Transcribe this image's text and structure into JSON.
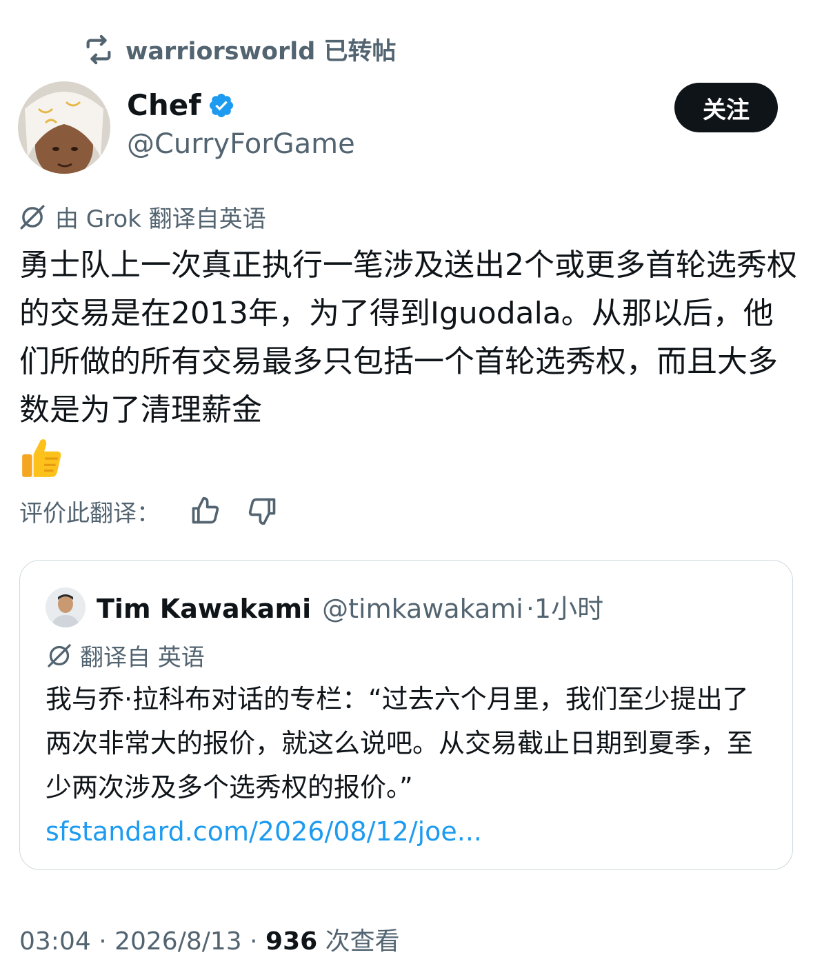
{
  "repost": {
    "text": "warriorsworld 已转帖",
    "icon": "repost-icon"
  },
  "author": {
    "name": "Chef",
    "handle": "@CurryForGame",
    "verified": true,
    "avatar": "avatar-photo"
  },
  "follow_button": "关注",
  "translation_note": "由 Grok 翻译自英语",
  "tweet_text": "勇士队上一次真正执行一笔涉及送出2个或更多首轮选秀权的交易是在2013年，为了得到Iguodala。从那以后，他们所做的所有交易最多只包括一个首轮选秀权，而且大多数是为了清理薪金",
  "tweet_emoji": "thumbs-up",
  "rate": {
    "label": "评价此翻译：",
    "up_icon": "thumbs-up-icon",
    "down_icon": "thumbs-down-icon"
  },
  "quote": {
    "name": "Tim Kawakami",
    "handle": "@timkawakami",
    "time": "·1小时",
    "translation_note": "翻译自 英语",
    "text": "我与乔·拉科布对话的专栏：“过去六个月里，我们至少提出了两次非常大的报价，就这么说吧。从交易截止日期到夏季，至少两次涉及多个选秀权的报价。”",
    "link": "sfstandard.com/2026/08/12/joe..."
  },
  "footer": {
    "time": "03:04 · 2026/8/13 ·",
    "views": "936",
    "views_label": "次查看"
  },
  "colors": {
    "accent": "#1d9bf0",
    "secondary_text": "#536471",
    "primary_text": "#0f1419",
    "border": "#cfd9de"
  }
}
